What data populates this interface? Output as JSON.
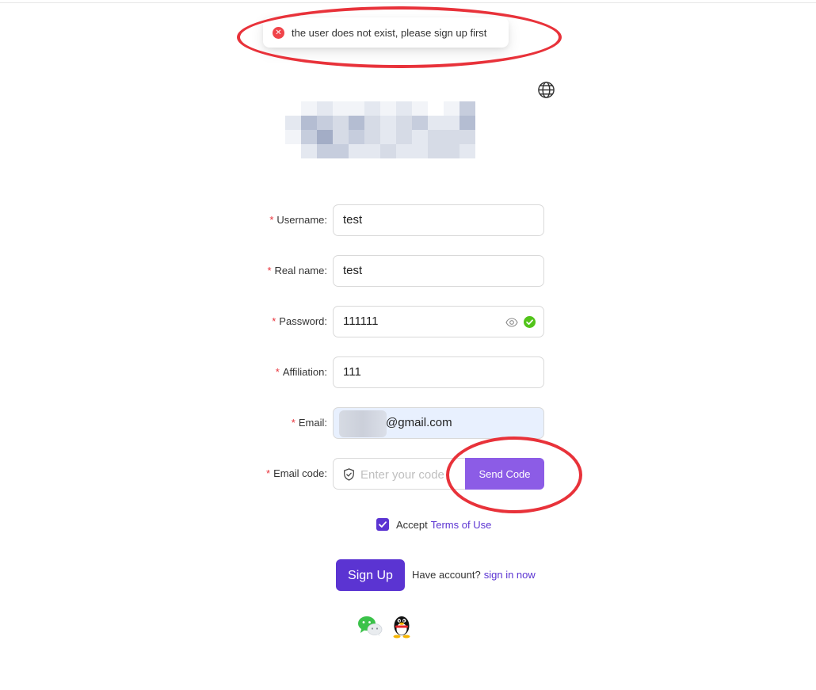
{
  "toast": {
    "message": "the user does not exist, please sign up first",
    "icon": "error-circle-icon"
  },
  "form": {
    "username": {
      "label": "Username",
      "value": "test"
    },
    "real_name": {
      "label": "Real name",
      "value": "test"
    },
    "password": {
      "label": "Password",
      "value": "111111"
    },
    "affiliation": {
      "label": "Affiliation",
      "value": "111"
    },
    "email": {
      "label": "Email",
      "value": "@gmail.com"
    },
    "email_code": {
      "label": "Email code",
      "placeholder": "Enter your code",
      "send_label": "Send Code"
    },
    "label_suffix": ":",
    "required_mark": "*"
  },
  "accept": {
    "prefix": "Accept",
    "link": "Terms of Use",
    "checked": true
  },
  "signup": {
    "button": "Sign Up",
    "have_account": "Have account?",
    "signin_link": "sign in now"
  },
  "colors": {
    "primary": "#5b34d2",
    "send_button": "#8c5ce6",
    "error": "#e8323a",
    "success": "#52c41a"
  }
}
